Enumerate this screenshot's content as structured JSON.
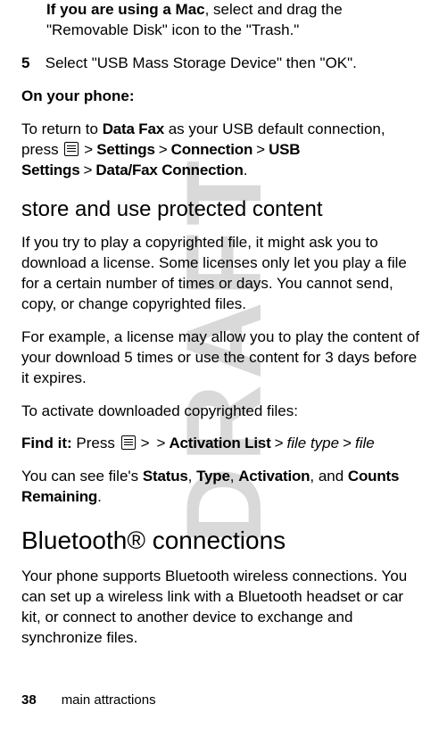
{
  "watermark": "DRAFT",
  "p1_lead": "If you are using a Mac",
  "p1_rest": ", select and drag the \"Removable Disk\" icon to the \"Trash.\"",
  "step5_num": "5",
  "step5_text": "Select \"USB Mass Storage Device\" then \"OK\".",
  "on_phone": "On your phone:",
  "p2a": "To return to ",
  "p2_datafax": "Data Fax",
  "p2b": " as your USB default connection, press ",
  "gt": ">",
  "bc": {
    "settings": "Settings",
    "connection": "Connection",
    "usb": "USB Settings",
    "dfc": "Data/Fax Connection"
  },
  "section1_title": "store and use protected content",
  "p3": "If you try to play a copyrighted file, it might ask you to download a license. Some licenses only let you play a file for a certain number of times or days. You cannot send, copy, or change copyrighted files.",
  "p4": "For example, a license may allow you to play the content of your download 5 times or use the content for 3 days before it expires.",
  "p5": "To activate downloaded copyrighted files:",
  "findit_label": "Find it:",
  "findit_press": " Press ",
  "findit_activation": "Activation List",
  "findit_filetype": "file type",
  "findit_file": "file",
  "p6a": "You can see file's ",
  "s_status": "Status",
  "s_type": "Type",
  "s_activation": "Activation",
  "s_and": ", and ",
  "s_counts": "Counts Remaining",
  "period": ".",
  "comma": ", ",
  "section2_title": "Bluetooth® connections",
  "p7": "Your phone supports Bluetooth wireless connections. You can set up a wireless link with a Bluetooth headset or car kit, or connect to another device to exchange and synchronize files.",
  "footer_page": "38",
  "footer_text": "main attractions"
}
